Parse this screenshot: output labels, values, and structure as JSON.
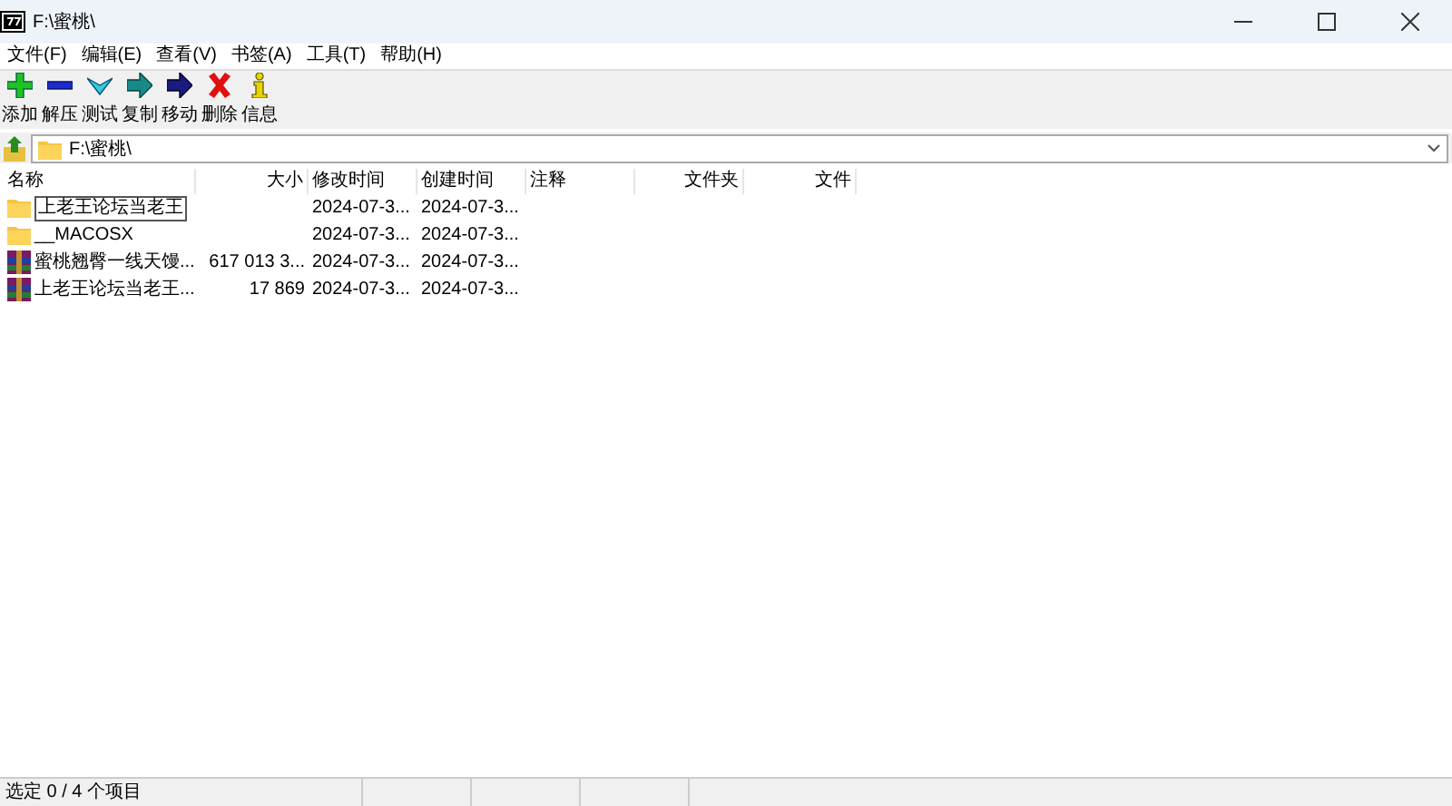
{
  "window": {
    "title": "F:\\蜜桃\\"
  },
  "menu": [
    "文件(F)",
    "编辑(E)",
    "查看(V)",
    "书签(A)",
    "工具(T)",
    "帮助(H)"
  ],
  "toolbar": [
    {
      "kind": "add",
      "label": "添加"
    },
    {
      "kind": "extract",
      "label": "解压"
    },
    {
      "kind": "test",
      "label": "测试"
    },
    {
      "kind": "copy",
      "label": "复制"
    },
    {
      "kind": "move",
      "label": "移动"
    },
    {
      "kind": "delete",
      "label": "删除"
    },
    {
      "kind": "info",
      "label": "信息"
    }
  ],
  "address": {
    "value": "F:\\蜜桃\\"
  },
  "table": {
    "columns": [
      {
        "label": "名称"
      },
      {
        "label": "大小"
      },
      {
        "label": "修改时间"
      },
      {
        "label": "创建时间"
      },
      {
        "label": "注释"
      },
      {
        "label": "文件夹"
      },
      {
        "label": "文件"
      }
    ],
    "rows": [
      {
        "kind": "folder",
        "editing": true,
        "cells": [
          "上老王论坛当老王",
          "",
          "2024-07-3...",
          "2024-07-3..."
        ]
      },
      {
        "kind": "folder",
        "editing": false,
        "cells": [
          "__MACOSX",
          "",
          "2024-07-3...",
          "2024-07-3..."
        ]
      },
      {
        "kind": "archive",
        "editing": false,
        "cells": [
          "蜜桃翘臀一线天馒...",
          "617 013 3...",
          "2024-07-3...",
          "2024-07-3..."
        ]
      },
      {
        "kind": "archive",
        "editing": false,
        "cells": [
          "上老王论坛当老王...",
          "17 869",
          "2024-07-3...",
          "2024-07-3..."
        ]
      }
    ]
  },
  "status_bar": "选定 0 / 4 个项目"
}
